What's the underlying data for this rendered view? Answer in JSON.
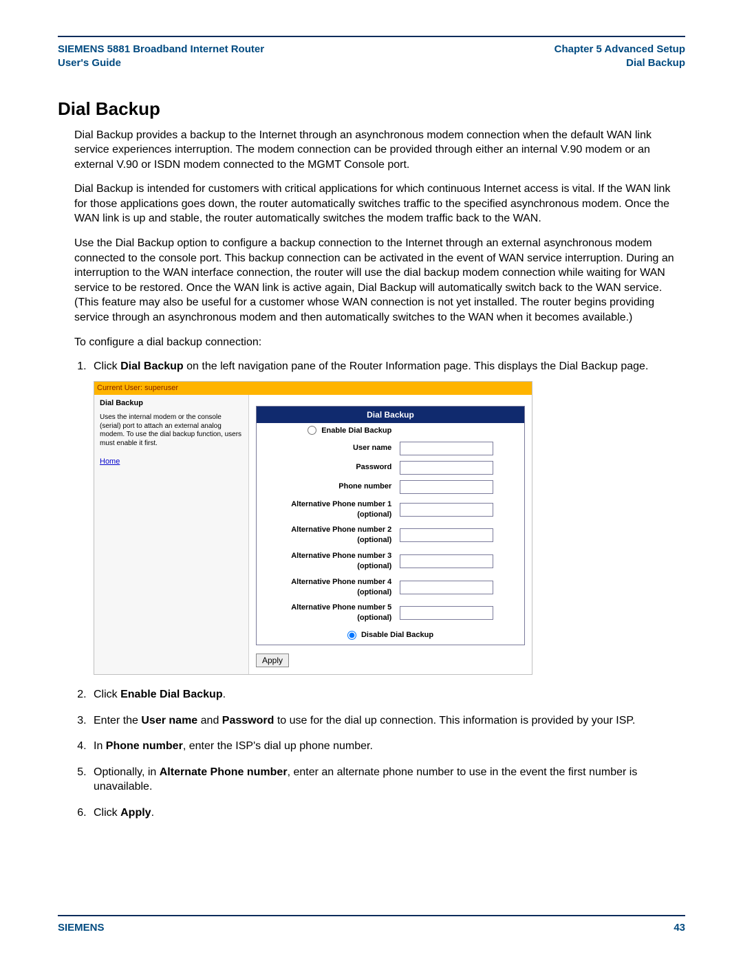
{
  "header": {
    "left_line1": "SIEMENS 5881 Broadband Internet Router",
    "left_line2": "User's Guide",
    "right_line1": "Chapter 5  Advanced Setup",
    "right_line2": "Dial Backup"
  },
  "title": "Dial Backup",
  "paragraphs": {
    "p1": "Dial Backup provides a backup to the Internet through an asynchronous modem connection when the default WAN link service experiences interruption. The modem connection can be provided through either an internal V.90 modem or an external V.90 or ISDN modem connected to the MGMT Console port.",
    "p2": "Dial Backup is intended for customers with critical applications for which continuous Internet access is vital. If the WAN link for those applications goes down, the router automatically switches traffic to the specified asynchronous modem. Once the WAN link is up and stable, the router automatically switches the modem traffic back to the WAN.",
    "p3": "Use the Dial Backup option to configure a backup connection to the Internet through an external asynchronous modem connected to the console port. This backup connection can be activated in the event of WAN service interruption. During an interruption to the WAN interface connection, the router will use the dial backup modem connection while waiting for WAN service to be restored. Once the WAN link is active again, Dial Backup will automatically switch back to the WAN service. (This feature may also be useful for a customer whose WAN connection is not yet installed. The router begins providing service through an asynchronous modem and then automatically switches to the WAN when it becomes available.)",
    "p4": "To configure a dial backup connection:"
  },
  "steps": {
    "s1_a": "Click ",
    "s1_b": "Dial Backup",
    "s1_c": " on the left navigation pane of the Router Information page. This displays the Dial Backup page.",
    "s2_a": "Click ",
    "s2_b": "Enable Dial Backup",
    "s2_c": ".",
    "s3_a": "Enter the ",
    "s3_b": "User name",
    "s3_c": " and ",
    "s3_d": "Password",
    "s3_e": " to use for the dial up connection. This information is provided by your ISP.",
    "s4_a": "In ",
    "s4_b": "Phone number",
    "s4_c": ", enter the ISP's dial up phone number.",
    "s5_a": "Optionally, in ",
    "s5_b": "Alternate Phone number",
    "s5_c": ", enter an alternate phone number to use in the event the first number is unavailable.",
    "s6_a": "Click ",
    "s6_b": "Apply",
    "s6_c": "."
  },
  "figure": {
    "current_user_label": "Current User: superuser",
    "side_title": "Dial Backup",
    "side_desc": "Uses the internal modem or the console (serial) port to attach an external analog modem.  To use the dial backup function, users must enable it first.",
    "home": "Home",
    "form": {
      "hdr": "Dial Backup",
      "enable_label": "Enable Dial Backup",
      "username": "User name",
      "password": "Password",
      "phone": "Phone number",
      "alt1": "Alternative Phone number 1 (optional)",
      "alt2": "Alternative Phone number 2 (optional)",
      "alt3": "Alternative Phone number 3 (optional)",
      "alt4": "Alternative Phone number 4 (optional)",
      "alt5": "Alternative Phone number 5 (optional)",
      "disable_label": "Disable Dial Backup",
      "apply": "Apply"
    }
  },
  "footer": {
    "left": "SIEMENS",
    "right": "43"
  }
}
